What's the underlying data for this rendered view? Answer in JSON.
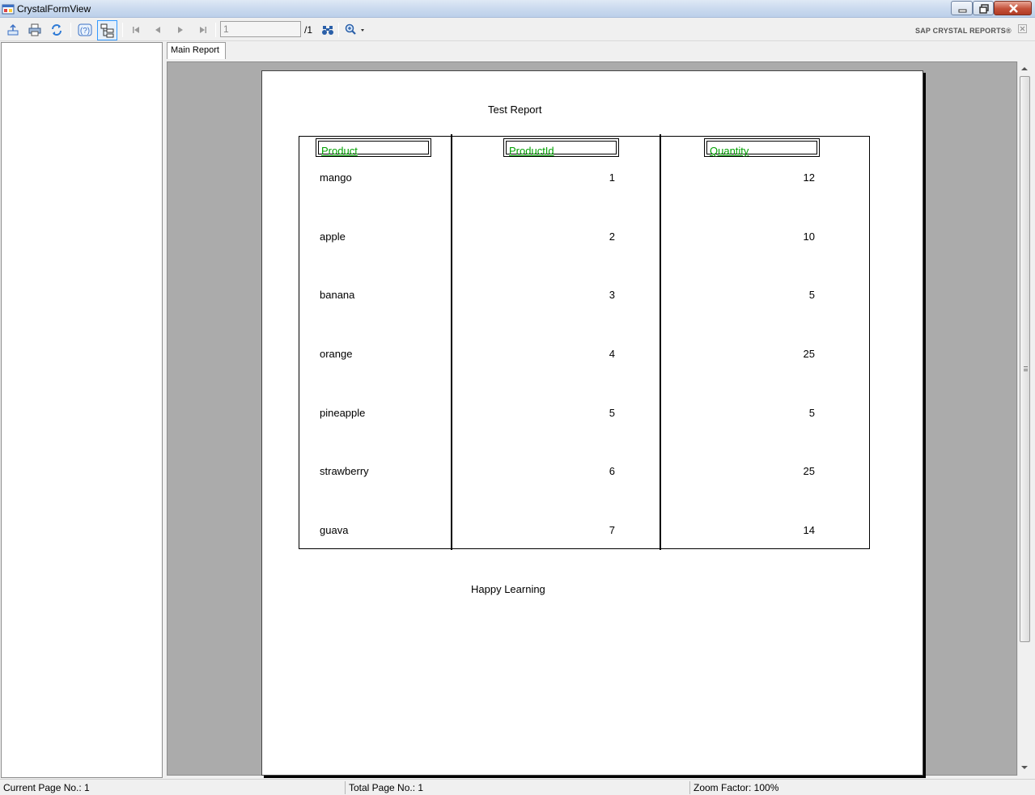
{
  "window": {
    "title": "CrystalFormView"
  },
  "toolbar": {
    "export_icon": "export-icon",
    "print_icon": "print-icon",
    "refresh_icon": "refresh-icon",
    "help_icon": "help-icon",
    "group_tree_icon": "group-tree-icon",
    "page_number_value": "1",
    "page_total": "/1",
    "brand": "SAP CRYSTAL REPORTS®"
  },
  "tabs": [
    {
      "label": "Main Report"
    }
  ],
  "report": {
    "title": "Test Report",
    "headers": [
      "Product",
      "ProductId",
      "Quantity"
    ],
    "rows": [
      [
        "mango",
        "1",
        "12"
      ],
      [
        "apple",
        "2",
        "10"
      ],
      [
        "banana",
        "3",
        "5"
      ],
      [
        "orange",
        "4",
        "25"
      ],
      [
        "pineapple",
        "5",
        "5"
      ],
      [
        "strawberry",
        "6",
        "25"
      ],
      [
        "guava",
        "7",
        "14"
      ]
    ],
    "footer": "Happy Learning",
    "header_color": "#00a000"
  },
  "status": {
    "current_page": "Current Page No.: 1",
    "total_pages": "Total Page No.: 1",
    "zoom": "Zoom Factor: 100%"
  }
}
